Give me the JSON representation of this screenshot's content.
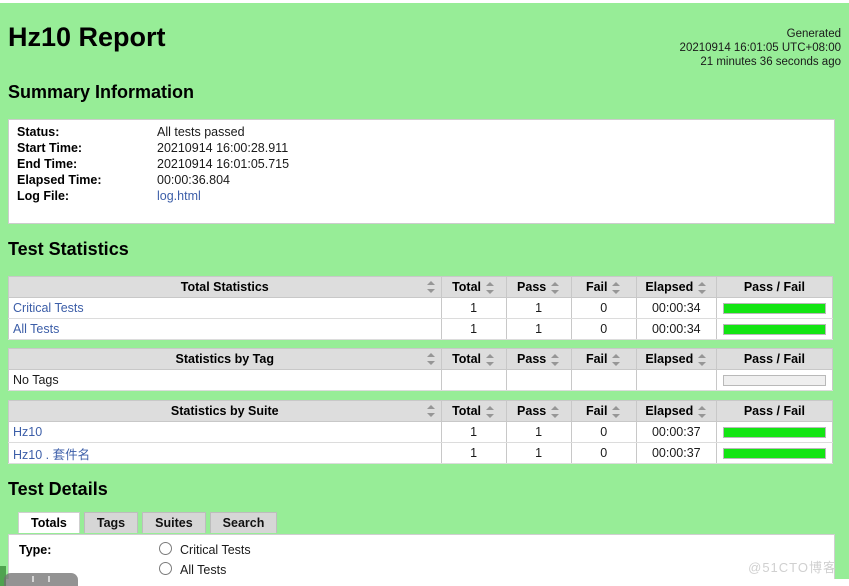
{
  "report": {
    "title": "Hz10 Report",
    "generated_label": "Generated",
    "generated_time": "20210914 16:01:05 UTC+08:00",
    "generated_ago": "21 minutes 36 seconds ago"
  },
  "summary": {
    "heading": "Summary Information",
    "rows": [
      {
        "label": "Status:",
        "value": "All tests passed",
        "kind": "status-pass"
      },
      {
        "label": "Start Time:",
        "value": "20210914 16:00:28.911",
        "kind": "text"
      },
      {
        "label": "End Time:",
        "value": "20210914 16:01:05.715",
        "kind": "text"
      },
      {
        "label": "Elapsed Time:",
        "value": "00:00:36.804",
        "kind": "text"
      },
      {
        "label": "Log File:",
        "value": "log.html",
        "kind": "link"
      }
    ]
  },
  "statistics": {
    "heading": "Test Statistics",
    "columns": [
      "Total",
      "Pass",
      "Fail",
      "Elapsed",
      "Pass / Fail"
    ],
    "tables": [
      {
        "name_header": "Total Statistics",
        "rows": [
          {
            "name": "Critical Tests",
            "total": "1",
            "pass": "1",
            "fail": "0",
            "elapsed": "00:00:34",
            "pass_pct": 100,
            "fail_pct": 0,
            "is_link": true
          },
          {
            "name": "All Tests",
            "total": "1",
            "pass": "1",
            "fail": "0",
            "elapsed": "00:00:34",
            "pass_pct": 100,
            "fail_pct": 0,
            "is_link": true
          }
        ]
      },
      {
        "name_header": "Statistics by Tag",
        "rows": [
          {
            "name": "No Tags",
            "total": "",
            "pass": "",
            "fail": "",
            "elapsed": "",
            "pass_pct": 0,
            "fail_pct": 0,
            "is_link": false
          }
        ]
      },
      {
        "name_header": "Statistics by Suite",
        "rows": [
          {
            "name": "Hz10",
            "total": "1",
            "pass": "1",
            "fail": "0",
            "elapsed": "00:00:37",
            "pass_pct": 100,
            "fail_pct": 0,
            "is_link": true
          },
          {
            "name": "Hz10 . 套件名",
            "total": "1",
            "pass": "1",
            "fail": "0",
            "elapsed": "00:00:37",
            "pass_pct": 100,
            "fail_pct": 0,
            "is_link": true
          }
        ]
      }
    ]
  },
  "details": {
    "heading": "Test Details",
    "tabs": [
      {
        "label": "Totals",
        "active": true
      },
      {
        "label": "Tags",
        "active": false
      },
      {
        "label": "Suites",
        "active": false
      },
      {
        "label": "Search",
        "active": false
      }
    ],
    "type_label": "Type:",
    "radio_options": [
      {
        "label": "Critical Tests",
        "checked": false
      },
      {
        "label": "All Tests",
        "checked": false
      }
    ]
  },
  "watermark": "@51CTO博客",
  "colors": {
    "page_background": "#97ed97",
    "pass_bar": "#13e513",
    "fail_bar": "#e81c1c",
    "empty_bar": "#efefef",
    "link": "#3c5ea8",
    "pass_text": "#2e8b2e",
    "table_header": "#dddddd"
  }
}
